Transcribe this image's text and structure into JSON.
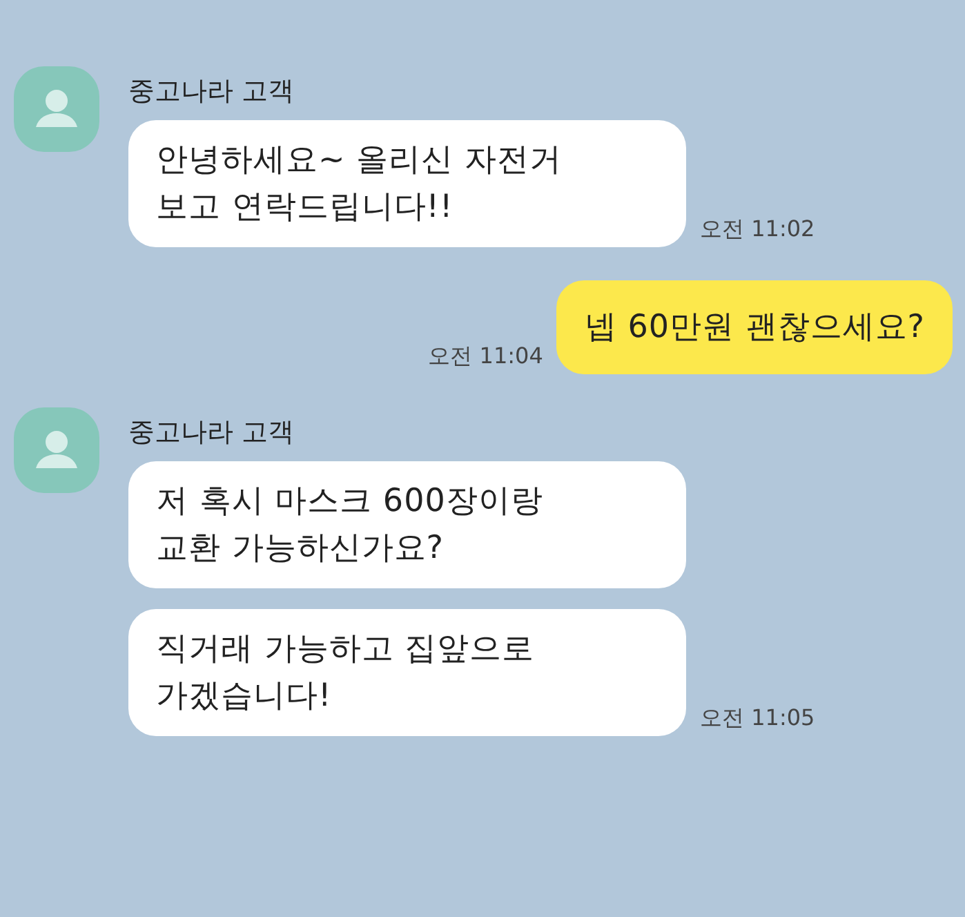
{
  "messages": [
    {
      "kind": "received",
      "sender": "중고나라 고객",
      "bubbles": [
        "안녕하세요~ 올리신 자전거\n보고 연락드립니다!!"
      ],
      "time": "오전 11:02"
    },
    {
      "kind": "sent",
      "bubbles": [
        "넵 60만원 괜찮으세요?"
      ],
      "time": "오전 11:04"
    },
    {
      "kind": "received",
      "sender": "중고나라 고객",
      "bubbles": [
        "저 혹시 마스크 600장이랑\n교환 가능하신가요?",
        "직거래 가능하고 집앞으로\n가겠습니다!"
      ],
      "time": "오전 11:05"
    }
  ]
}
